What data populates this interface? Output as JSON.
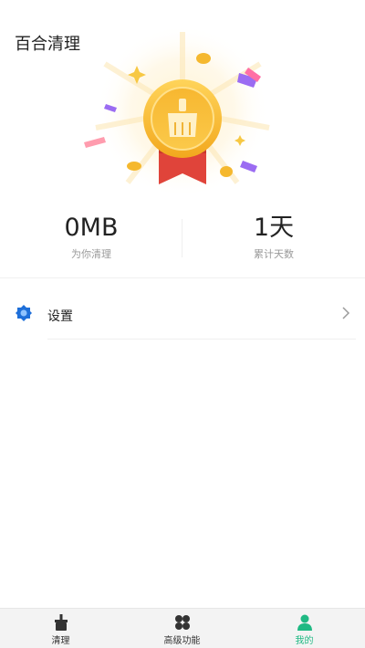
{
  "header": {
    "title": "百合清理"
  },
  "stats": {
    "cleaned_value": "0MB",
    "cleaned_label": "为你清理",
    "days_value": "1天",
    "days_label": "累计天数"
  },
  "settings": {
    "label": "设置"
  },
  "tabs": [
    {
      "label": "清理"
    },
    {
      "label": "高级功能"
    },
    {
      "label": "我的"
    }
  ],
  "colors": {
    "accent": "#1fb983",
    "gold": "#f5b82e",
    "ribbon": "#e0443a"
  }
}
